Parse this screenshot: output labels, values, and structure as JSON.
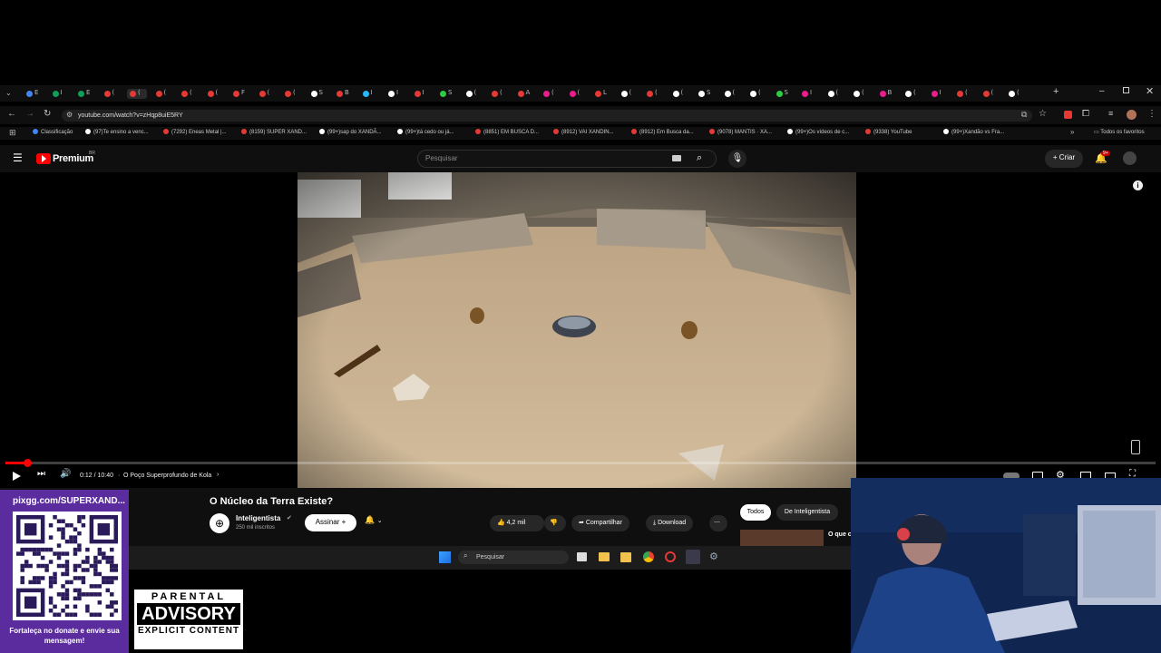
{
  "browser": {
    "url": "youtube.com/watch?v=zHqp8uiE5RY",
    "tabs": [
      {
        "color": "#4285f4",
        "t": "E"
      },
      {
        "color": "#0f9d58",
        "t": "I"
      },
      {
        "color": "#0f9d58",
        "t": "E"
      },
      {
        "color": "#e53935",
        "t": "("
      },
      {
        "color": "#e53935",
        "t": "("
      },
      {
        "color": "#e53935",
        "t": "("
      },
      {
        "color": "#e53935",
        "t": "("
      },
      {
        "color": "#e53935",
        "t": "("
      },
      {
        "color": "#e53935",
        "t": "F"
      },
      {
        "color": "#e53935",
        "t": "("
      },
      {
        "color": "#e53935",
        "t": "("
      },
      {
        "color": "#ffffff",
        "t": "S"
      },
      {
        "color": "#e53935",
        "t": "B"
      },
      {
        "color": "#29b6f6",
        "t": "I"
      },
      {
        "color": "#ffffff",
        "t": "I"
      },
      {
        "color": "#e53935",
        "t": "I"
      },
      {
        "color": "#2ecc40",
        "t": "S"
      },
      {
        "color": "#ffffff",
        "t": "("
      },
      {
        "color": "#e53935",
        "t": "("
      },
      {
        "color": "#e53935",
        "t": "A"
      },
      {
        "color": "#e91e8c",
        "t": "("
      },
      {
        "color": "#e91e8c",
        "t": "("
      },
      {
        "color": "#e53935",
        "t": "L"
      },
      {
        "color": "#ffffff",
        "t": "("
      },
      {
        "color": "#e53935",
        "t": "("
      },
      {
        "color": "#ffffff",
        "t": "("
      },
      {
        "color": "#ffffff",
        "t": "S"
      },
      {
        "color": "#ffffff",
        "t": "("
      },
      {
        "color": "#ffffff",
        "t": "("
      },
      {
        "color": "#2ecc40",
        "t": "S"
      },
      {
        "color": "#e91e8c",
        "t": "I"
      },
      {
        "color": "#ffffff",
        "t": "("
      },
      {
        "color": "#ffffff",
        "t": "("
      },
      {
        "color": "#e91e8c",
        "t": "B"
      },
      {
        "color": "#ffffff",
        "t": "("
      },
      {
        "color": "#e91e8c",
        "t": "I"
      },
      {
        "color": "#e53935",
        "t": "("
      },
      {
        "color": "#e53935",
        "t": "("
      },
      {
        "color": "#ffffff",
        "t": "("
      }
    ],
    "bookmarks": [
      {
        "color": "#4285f4",
        "label": "Classificação"
      },
      {
        "color": "#ffffff",
        "label": "(97)Te ensino a venc..."
      },
      {
        "color": "#e53935",
        "label": "(7292) Eneas Metal |..."
      },
      {
        "color": "#e53935",
        "label": "(8159) SUPER XAND..."
      },
      {
        "color": "#ffffff",
        "label": "(99+)sap do XANDÃ..."
      },
      {
        "color": "#ffffff",
        "label": "(99+)tá cedo ou já..."
      },
      {
        "color": "#e53935",
        "label": "(8851) EM BUSCA D..."
      },
      {
        "color": "#e53935",
        "label": "(8912) VAI XANDIN..."
      },
      {
        "color": "#e53935",
        "label": "(8912) Em Busca da..."
      },
      {
        "color": "#e53935",
        "label": "(9078) MANTIS · XA..."
      },
      {
        "color": "#ffffff",
        "label": "(99+)Os vídeos de c..."
      },
      {
        "color": "#e53935",
        "label": "(9338) YouTube"
      },
      {
        "color": "#ffffff",
        "label": "(99+)Xandão vs Fra..."
      }
    ],
    "all_bookmarks": "Todos os favoritos"
  },
  "youtube": {
    "logo": "Premium",
    "region": "BR",
    "search_placeholder": "Pesquisar",
    "create": "Criar",
    "notifications": "9+",
    "video": {
      "time": "0:12 / 10:40",
      "chapter": "O Poço Superprofundo de Kola",
      "progress": 0.019,
      "title": "O Núcleo da Terra Existe?"
    },
    "channel": {
      "name": "Inteligentista",
      "subs": "250 mil inscritos",
      "subscribe": "Assinar"
    },
    "actions": {
      "likes": "4,2 mil",
      "share": "Compartilhar",
      "download": "Download"
    },
    "chips": [
      "Todos",
      "De Inteligentista"
    ],
    "rec_title": "O que c..."
  },
  "taskbar": {
    "search": "Pesquisar"
  },
  "overlay": {
    "banner": "pixgg.com/SUPERXAND...",
    "caption": "Fortaleça no donate e envie sua mensagem!",
    "parental": "PARENTAL",
    "advisory": "ADVISORY",
    "explicit": "EXPLICIT CONTENT"
  }
}
